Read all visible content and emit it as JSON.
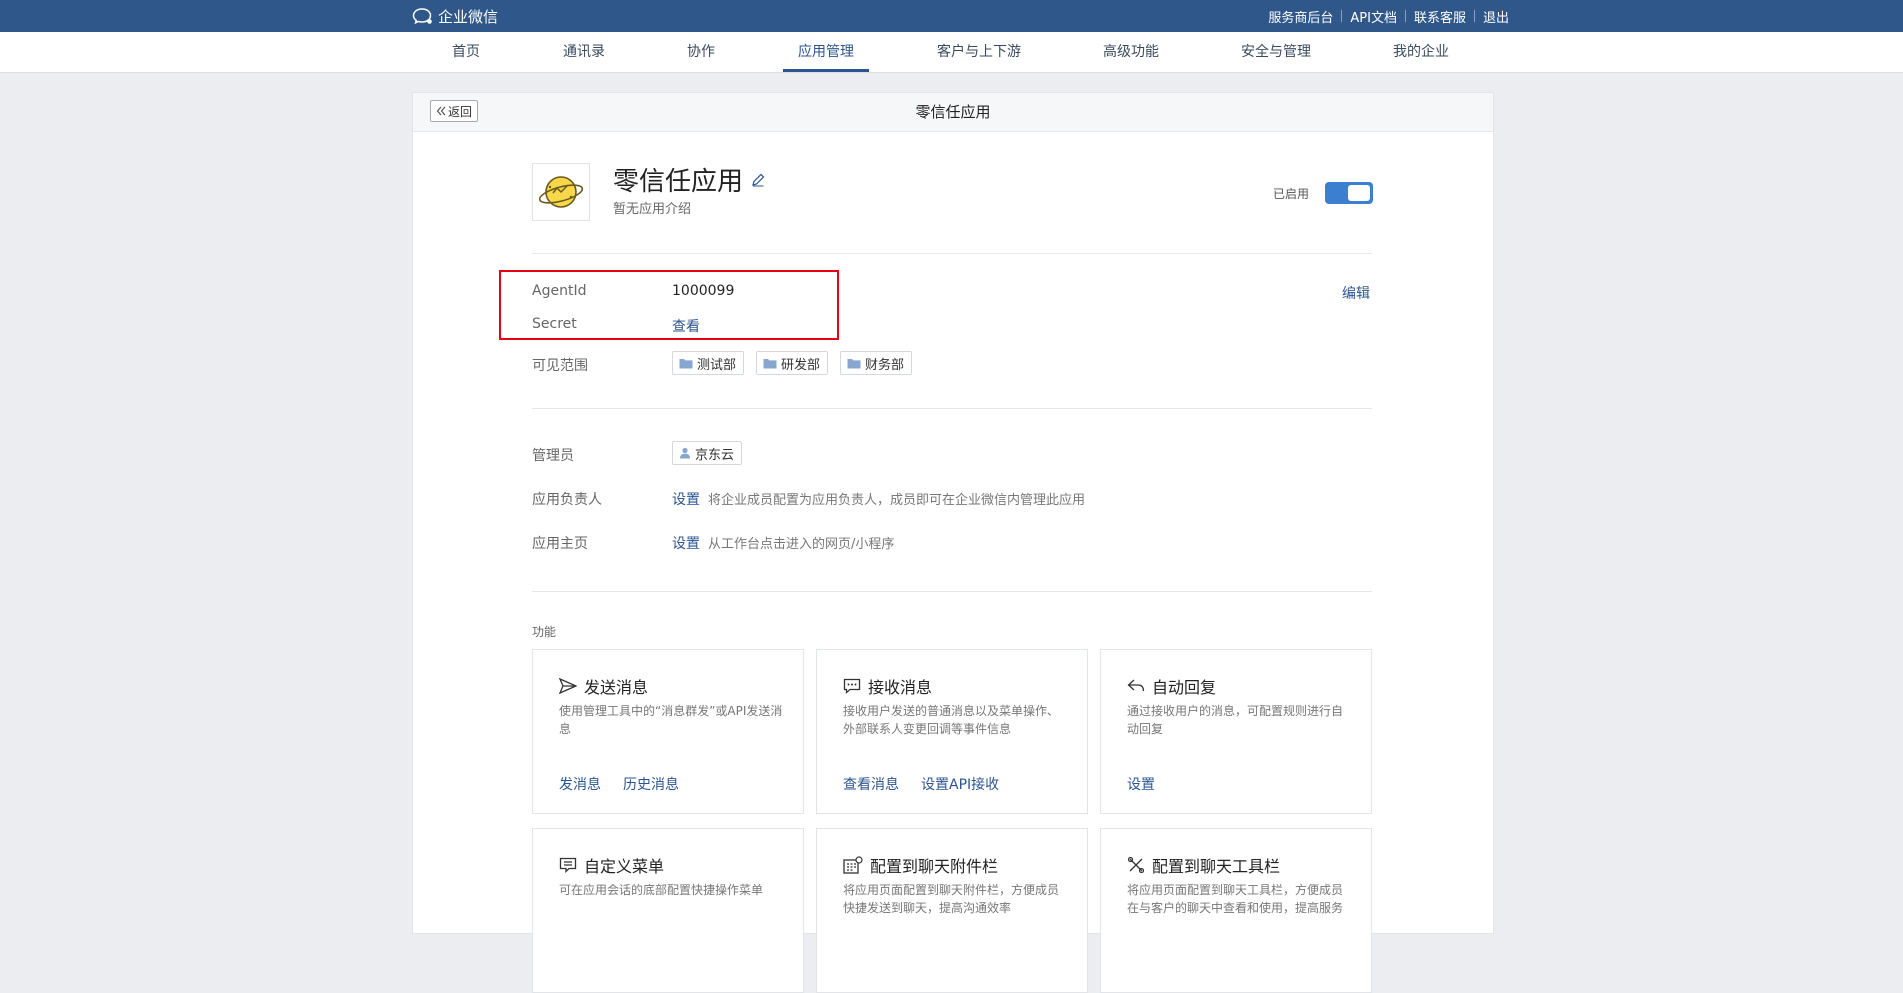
{
  "topbar": {
    "brand": "企业微信",
    "links": [
      "服务商后台",
      "API文档",
      "联系客服",
      "退出"
    ]
  },
  "nav": {
    "items": [
      "首页",
      "通讯录",
      "协作",
      "应用管理",
      "客户与上下游",
      "高级功能",
      "安全与管理",
      "我的企业"
    ],
    "active": "应用管理"
  },
  "page": {
    "back": "返回",
    "title": "零信任应用"
  },
  "app": {
    "name": "零信任应用",
    "desc": "暂无应用介绍",
    "status": "已启用",
    "enabled": true
  },
  "credentials": {
    "agentid_label": "AgentId",
    "agentid_value": "1000099",
    "secret_label": "Secret",
    "secret_action": "查看",
    "edit": "编辑"
  },
  "visibility": {
    "label": "可见范围",
    "departments": [
      "测试部",
      "研发部",
      "财务部"
    ]
  },
  "admins": {
    "label": "管理员",
    "users": [
      "京东云"
    ]
  },
  "owner": {
    "label": "应用负责人",
    "action": "设置",
    "hint": "将企业成员配置为应用负责人，成员即可在企业微信内管理此应用"
  },
  "homepage": {
    "label": "应用主页",
    "action": "设置",
    "hint": "从工作台点击进入的网页/小程序"
  },
  "features": {
    "title": "功能",
    "cards": [
      {
        "icon": "send-icon",
        "title": "发送消息",
        "desc": "使用管理工具中的“消息群发”或API发送消息",
        "links": [
          "发消息",
          "历史消息"
        ]
      },
      {
        "icon": "chat-icon",
        "title": "接收消息",
        "desc": "接收用户发送的普通消息以及菜单操作、外部联系人变更回调等事件信息",
        "links": [
          "查看消息",
          "设置API接收"
        ]
      },
      {
        "icon": "reply-icon",
        "title": "自动回复",
        "desc": "通过接收用户的消息，可配置规则进行自动回复",
        "links": [
          "设置"
        ]
      },
      {
        "icon": "menu-icon",
        "title": "自定义菜单",
        "desc": "可在应用会话的底部配置快捷操作菜单",
        "links": []
      },
      {
        "icon": "attachment-icon",
        "title": "配置到聊天附件栏",
        "desc": "将应用页面配置到聊天附件栏，方便成员快捷发送到聊天，提高沟通效率",
        "links": []
      },
      {
        "icon": "toolbar-icon",
        "title": "配置到聊天工具栏",
        "desc": "将应用页面配置到聊天工具栏，方便成员在与客户的聊天中查看和使用，提高服务",
        "links": []
      }
    ]
  }
}
